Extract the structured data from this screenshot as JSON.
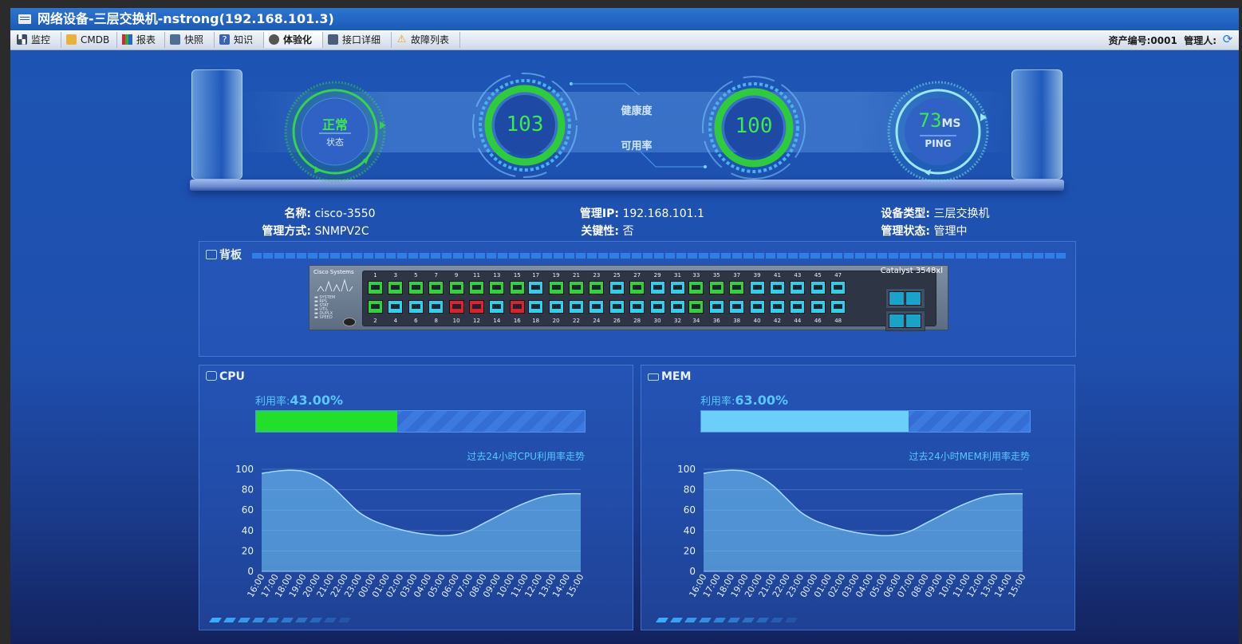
{
  "window": {
    "title": "网络设备-三层交换机-nstrong(192.168.101.3)"
  },
  "tabs": [
    {
      "label": "监控",
      "icon": "monitor-icon"
    },
    {
      "label": "CMDB",
      "icon": "cmdb-icon"
    },
    {
      "label": "报表",
      "icon": "report-icon"
    },
    {
      "label": "快照",
      "icon": "snapshot-icon"
    },
    {
      "label": "知识",
      "icon": "knowledge-icon"
    },
    {
      "label": "体验化",
      "icon": "experience-icon"
    },
    {
      "label": "接口详细",
      "icon": "interface-icon"
    },
    {
      "label": "故障列表",
      "icon": "warning-icon"
    }
  ],
  "header_right": {
    "asset": "资产编号:0001",
    "manager": "管理人:"
  },
  "gauges": {
    "status": {
      "value": "正常",
      "label": "状态"
    },
    "health": {
      "value": "103",
      "label": "健康度"
    },
    "availability": {
      "value": "100",
      "label": "可用率"
    },
    "ping": {
      "value": "73",
      "unit": "MS",
      "label": "PING"
    }
  },
  "device_info": {
    "name_label": "名称:",
    "name": "cisco-3550",
    "mgmt_method_label": "管理方式:",
    "mgmt_method": "SNMPV2C",
    "mgmt_ip_label": "管理IP:",
    "mgmt_ip": "192.168.101.1",
    "criticality_label": "关键性:",
    "criticality": "否",
    "device_type_label": "设备类型:",
    "device_type": "三层交换机",
    "mgmt_status_label": "管理状态:",
    "mgmt_status": "管理中"
  },
  "backplane": {
    "title": "背板",
    "brand": "Cisco Systems",
    "model": "Catalyst 3548xl",
    "leds": [
      "SYSTEM",
      "RPS",
      "STAT",
      "UTIL",
      "DUPLX",
      "SPEED"
    ],
    "top_ports": [
      "1",
      "3",
      "5",
      "7",
      "9",
      "11",
      "13",
      "15",
      "17",
      "19",
      "21",
      "23",
      "25",
      "27",
      "29",
      "31",
      "33",
      "35",
      "37",
      "39",
      "41",
      "43",
      "45",
      "47"
    ],
    "bottom_ports": [
      "2",
      "4",
      "6",
      "8",
      "10",
      "12",
      "14",
      "16",
      "18",
      "20",
      "22",
      "24",
      "26",
      "28",
      "30",
      "32",
      "34",
      "36",
      "38",
      "40",
      "42",
      "44",
      "46",
      "48"
    ],
    "top_states": [
      "green",
      "green",
      "green",
      "green",
      "green",
      "green",
      "green",
      "green",
      "cyan",
      "green",
      "green",
      "green",
      "cyan",
      "green",
      "cyan",
      "cyan",
      "green",
      "green",
      "green",
      "cyan",
      "cyan",
      "cyan",
      "cyan",
      "cyan"
    ],
    "bottom_states": [
      "green",
      "cyan",
      "cyan",
      "cyan",
      "red",
      "red",
      "cyan",
      "red",
      "cyan",
      "cyan",
      "cyan",
      "cyan",
      "cyan",
      "cyan",
      "cyan",
      "cyan",
      "green",
      "cyan",
      "cyan",
      "cyan",
      "cyan",
      "cyan",
      "cyan",
      "cyan"
    ]
  },
  "cpu": {
    "title": "CPU",
    "util_label": "利用率:",
    "util_value": "43.00%",
    "util_fraction": 0.43,
    "fill_color": "#22e02a",
    "trend_label": "过去24小时CPU利用率走势"
  },
  "mem": {
    "title": "MEM",
    "util_label": "利用率:",
    "util_value": "63.00%",
    "util_fraction": 0.63,
    "fill_color": "#6ccff8",
    "trend_label": "过去24小时MEM利用率走势"
  },
  "chart_data": [
    {
      "type": "area",
      "x": [
        "16:00",
        "17:00",
        "18:00",
        "19:00",
        "20:00",
        "21:00",
        "22:00",
        "23:00",
        "00:00",
        "01:00",
        "02:00",
        "03:00",
        "04:00",
        "05:00",
        "06:00",
        "07:00",
        "08:00",
        "09:00",
        "10:00",
        "11:00",
        "12:00",
        "13:00",
        "14:00",
        "15:00"
      ],
      "values": [
        96,
        98,
        99,
        98,
        93,
        84,
        71,
        58,
        50,
        45,
        41,
        38,
        36,
        35,
        36,
        40,
        47,
        54,
        61,
        67,
        72,
        75,
        76,
        76
      ],
      "ylim": [
        0,
        100
      ],
      "yticks": [
        0,
        20,
        40,
        60,
        80,
        100
      ],
      "grid": true
    },
    {
      "type": "area",
      "x": [
        "16:00",
        "17:00",
        "18:00",
        "19:00",
        "20:00",
        "21:00",
        "22:00",
        "23:00",
        "00:00",
        "01:00",
        "02:00",
        "03:00",
        "04:00",
        "05:00",
        "06:00",
        "07:00",
        "08:00",
        "09:00",
        "10:00",
        "11:00",
        "12:00",
        "13:00",
        "14:00",
        "15:00"
      ],
      "values": [
        96,
        98,
        99,
        98,
        93,
        84,
        71,
        58,
        50,
        45,
        41,
        38,
        36,
        35,
        36,
        40,
        47,
        54,
        61,
        67,
        72,
        75,
        76,
        76
      ],
      "ylim": [
        0,
        100
      ],
      "yticks": [
        0,
        20,
        40,
        60,
        80,
        100
      ],
      "grid": true
    }
  ]
}
